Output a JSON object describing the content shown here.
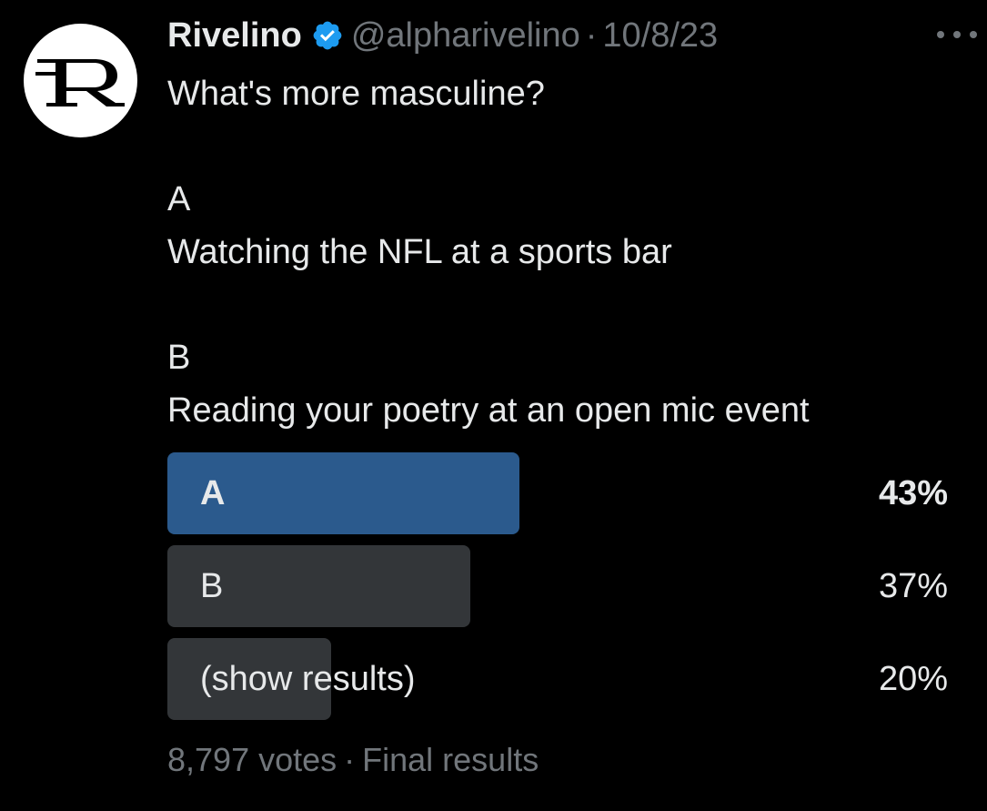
{
  "tweet": {
    "author": {
      "display_name": "Rivelino",
      "handle": "@alpharivelino",
      "verified": true,
      "avatar_icon": "rivelino-r-logo",
      "verified_icon": "verified-badge-icon",
      "verified_color": "#1d9bf0"
    },
    "separator": "·",
    "date": "10/8/23",
    "more_icon": "more-dots-icon",
    "text": {
      "question": "What's more masculine?",
      "option_a_letter": "A",
      "option_a_text": "Watching the NFL at a sports bar",
      "option_b_letter": "B",
      "option_b_text": "Reading your poetry at an open mic event"
    }
  },
  "poll": {
    "options": [
      {
        "label": "A",
        "percent_text": "43%",
        "share": 0.43,
        "winner": true
      },
      {
        "label": "B",
        "percent_text": "37%",
        "share": 0.37,
        "winner": false
      },
      {
        "label": "(show results)",
        "percent_text": "20%",
        "share": 0.2,
        "winner": false
      }
    ],
    "votes": "8,797 votes",
    "footer_separator": "·",
    "status": "Final results"
  },
  "colors": {
    "background": "#000000",
    "text": "#e7e9ea",
    "secondary_text": "#71767b",
    "winner_bar": "#2b5a8d",
    "other_bar": "#333639",
    "verified": "#1d9bf0"
  }
}
